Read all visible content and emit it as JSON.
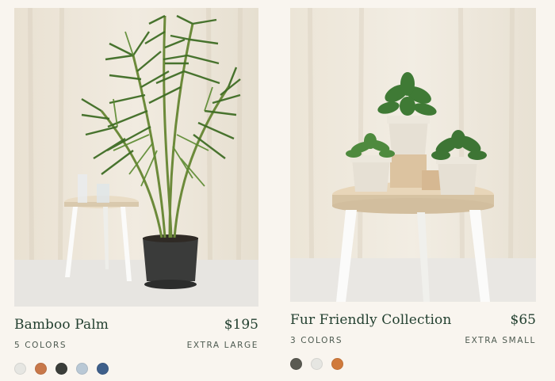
{
  "products": [
    {
      "name": "Bamboo Palm",
      "price": "$195",
      "colors_label": "5 COLORS",
      "size": "EXTRA LARGE",
      "swatches": [
        "#e6e6e2",
        "#c8784a",
        "#3a3d39",
        "#b9c8d5",
        "#3e5f8a"
      ]
    },
    {
      "name": "Fur Friendly Collection",
      "price": "$65",
      "colors_label": "3 COLORS",
      "size": "EXTRA SMALL",
      "swatches": [
        "#5a5a52",
        "#e6e6e2",
        "#d07a3c"
      ]
    }
  ],
  "icons": {
    "left_photo": "bamboo-palm-photo",
    "right_photo": "fur-friendly-collection-photo"
  }
}
